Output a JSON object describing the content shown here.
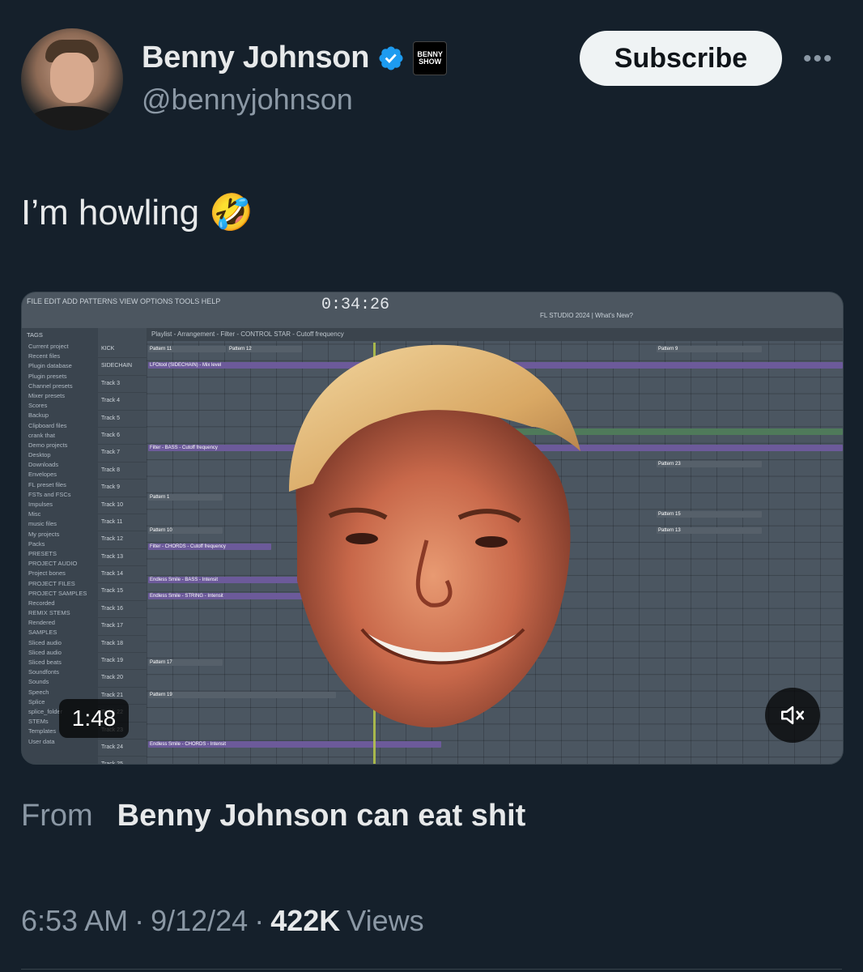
{
  "author": {
    "display_name": "Benny Johnson",
    "handle": "@bennyjohnson",
    "verified_icon": "verified-badge-icon",
    "affiliate_badge": "BENNY SHOW"
  },
  "header": {
    "subscribe_label": "Subscribe",
    "more_label": "•••"
  },
  "tweet": {
    "text": "I’m howling 🤣"
  },
  "media": {
    "duration": "1:48",
    "app_menu": "FILE EDIT ADD PATTERNS VIEW OPTIONS TOOLS HELP",
    "app_time": "0:34:26",
    "app_version": "FL STUDIO 2024 | What's New?",
    "playlist_title": "Playlist - Arrangement - Filter - CONTROL STAR - Cutoff frequency",
    "browser_header": "TAGS",
    "browser_items": [
      "Current project",
      "Recent files",
      "Plugin database",
      "Plugin presets",
      "Channel presets",
      "Mixer presets",
      "Scores",
      "Backup",
      "Clipboard files",
      "crank that",
      "Demo projects",
      "Desktop",
      "Downloads",
      "Envelopes",
      "FL preset files",
      "FSTs and FSCs",
      "Impulses",
      "Misc",
      "music files",
      "My projects",
      "Packs",
      "PRESETS",
      "PROJECT AUDIO",
      "Project bones",
      "PROJECT FILES",
      "PROJECT SAMPLES",
      "Recorded",
      "REMIX STEMS",
      "Rendered",
      "SAMPLES",
      "Sliced audio",
      "Sliced audio",
      "Sliced beats",
      "Soundfonts",
      "Sounds",
      "Speech",
      "Splice",
      "splice_folder",
      "STEMs",
      "Templates",
      "User data"
    ],
    "tracks": [
      "KICK",
      "SIDECHAIN",
      "Track 3",
      "Track 4",
      "Track 5",
      "Track 6",
      "Track 7",
      "Track 8",
      "Track 9",
      "Track 10",
      "Track 11",
      "Track 12",
      "Track 13",
      "Track 14",
      "Track 15",
      "Track 16",
      "Track 17",
      "Track 18",
      "Track 19",
      "Track 20",
      "Track 21",
      "Track 22",
      "Track 23",
      "Track 24",
      "Track 25"
    ],
    "clips": {
      "c1": "Pattern 11",
      "c2": "Pattern 12",
      "c3": "LFOtool (SIDECHAIN) - Mix level",
      "c4": "Filter - BASS - Cutoff frequency",
      "c5": "Pattern 1",
      "c6": "Pattern 10",
      "c7": "Filter - CHORDS - Cutoff frequency",
      "c8": "Endless Smile - BASS - Intensit",
      "c9": "Endless Smile - STRING - Intensit",
      "c10": "Pattern 17",
      "c11": "Pattern 19",
      "c12": "Endless Smile - CHORDS - Intensit",
      "c13": "Pattern 9",
      "c14": "Pattern 23",
      "c15": "Pattern 15",
      "c16": "Pattern 13"
    },
    "mute_icon": "speaker-muted-icon"
  },
  "source": {
    "from_label": "From",
    "from_name": "Benny Johnson can eat shit"
  },
  "meta": {
    "time": "6:53 AM",
    "sep1": "·",
    "date": "9/12/24",
    "sep2": "·",
    "views_count": "422K",
    "views_label": "Views"
  }
}
